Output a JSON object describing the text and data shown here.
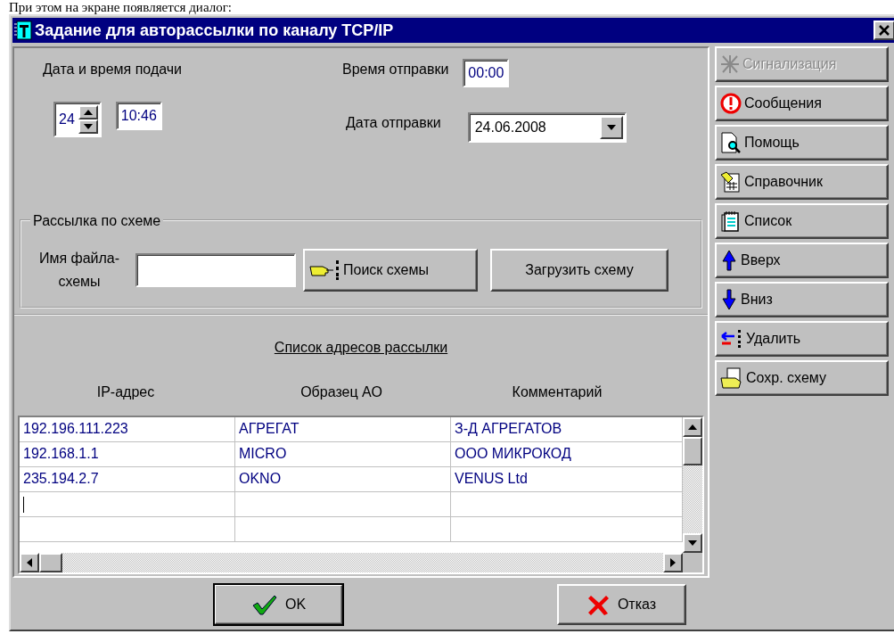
{
  "caption": "При этом на экране появляется диалог:",
  "window": {
    "title": "Задание для авторассылки по каналу TCP/IP"
  },
  "submission": {
    "label": "Дата и время подачи",
    "day": "24",
    "time": "10:46"
  },
  "send_time": {
    "label": "Время отправки",
    "value": "00:00"
  },
  "send_date": {
    "label": "Дата отправки",
    "value": "24.06.2008"
  },
  "scheme_group": {
    "title": "Рассылка по схеме",
    "file_label": "Имя файла-схемы",
    "find_button": "Поиск схемы",
    "load_button": "Загрузить схему"
  },
  "address_list": {
    "title": "Список адресов рассылки",
    "columns": [
      "IP-адрес",
      "Образец АО",
      "Комментарий"
    ],
    "rows": [
      [
        "192.196.111.223",
        "АГРЕГАТ",
        "З-Д АГРЕГАТОВ"
      ],
      [
        "192.168.1.1",
        "MICRO",
        "ООО МИКРОКОД"
      ],
      [
        "235.194.2.7",
        "OKNO",
        "VENUS Ltd"
      ]
    ],
    "input_row": {
      "cursor": true
    }
  },
  "side_buttons": [
    {
      "label": "Сигнализация",
      "disabled": true
    },
    {
      "label": "Сообщения",
      "disabled": false
    },
    {
      "label": "Помощь",
      "disabled": false
    },
    {
      "label": "Справочник",
      "disabled": false
    },
    {
      "label": "Список",
      "disabled": false
    },
    {
      "label": "Вверх",
      "disabled": false
    },
    {
      "label": "Вниз",
      "disabled": false
    },
    {
      "label": "Удалить",
      "disabled": false
    },
    {
      "label": "Сохр. схему",
      "disabled": false
    }
  ],
  "footer_buttons": [
    {
      "label": "OK",
      "default": true
    },
    {
      "label": "Отказ",
      "default": false
    }
  ]
}
